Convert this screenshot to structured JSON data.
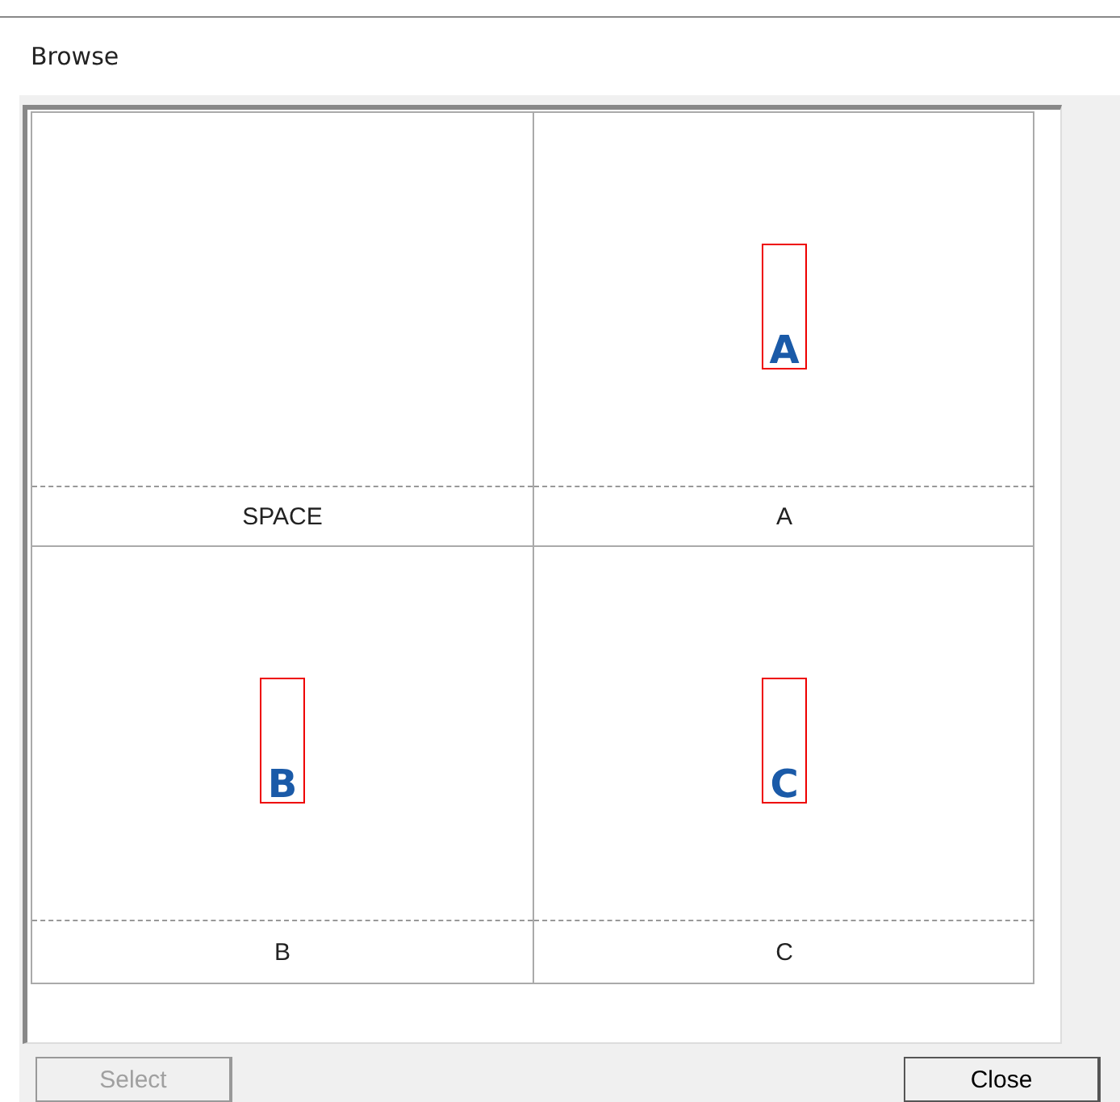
{
  "window": {
    "title": "Browse"
  },
  "character_rows": [
    {
      "cells": [
        {
          "label": "SPACE",
          "selected": false
        },
        {
          "glyph": "A",
          "label": "A",
          "selected": false
        }
      ]
    },
    {
      "cells": [
        {
          "glyph": "B",
          "label": "B",
          "selected": false
        },
        {
          "glyph": "C",
          "label": "C",
          "selected": false
        }
      ]
    }
  ],
  "buttons": [
    {
      "label": "Select",
      "kind": "select",
      "disabled": true
    },
    {
      "label": "Close",
      "kind": "close",
      "disabled": false
    }
  ]
}
